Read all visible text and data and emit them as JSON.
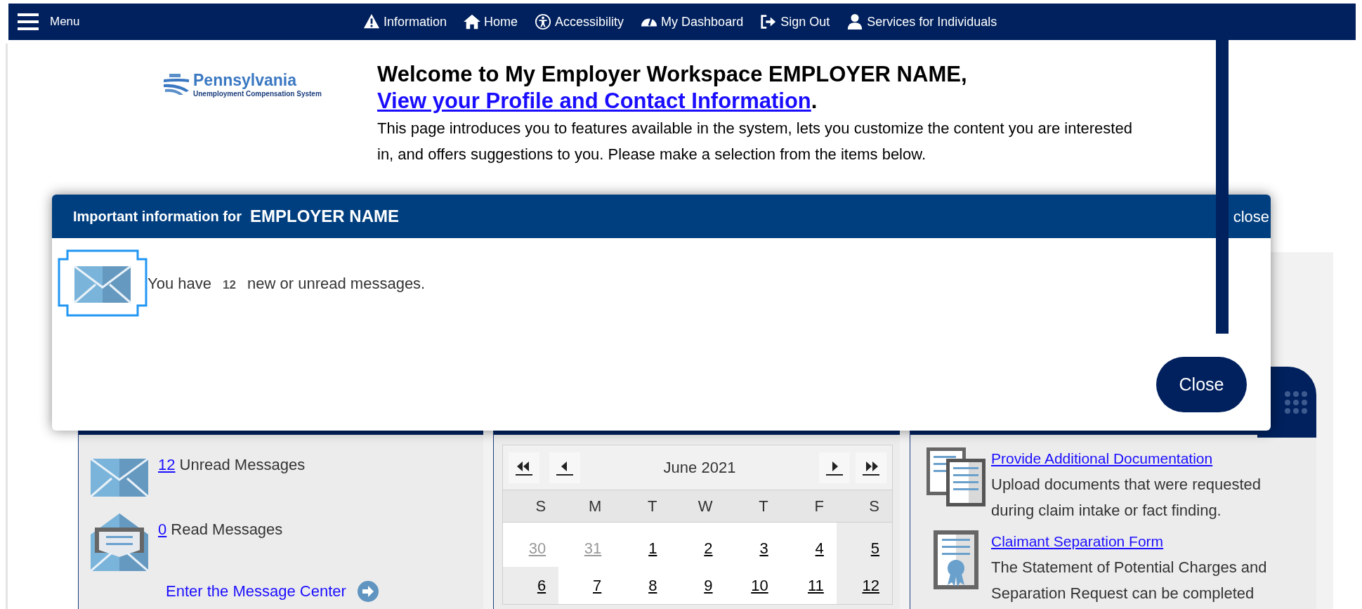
{
  "top_nav": {
    "menu_label": "Menu",
    "items": [
      {
        "label": "Information"
      },
      {
        "label": "Home"
      },
      {
        "label": "Accessibility"
      },
      {
        "label": "My Dashboard"
      },
      {
        "label": "Sign Out"
      },
      {
        "label": "Services for Individuals"
      }
    ]
  },
  "header": {
    "logo": {
      "title": "Pennsylvania",
      "subtitle": "Unemployment Compensation System"
    },
    "welcome": "Welcome to My Employer Workspace",
    "employer_name": "EMPLOYER NAME,",
    "profile_link": "View your Profile and Contact Information",
    "link_end": ".",
    "intro": "This page introduces you to features available in the system, lets you customize the content you are interested in, and offers suggestions to you. Please make a selection from the items below."
  },
  "modal": {
    "title": "Important information for",
    "employer_name": "EMPLOYER NAME",
    "close_link": "close",
    "message_prefix": "You have",
    "message_count": "12",
    "message_suffix": "new or unread messages.",
    "button": "Close"
  },
  "messages_panel": {
    "unread_count": "12",
    "unread_label": "Unread Messages",
    "read_count": "0",
    "read_label": "Read Messages",
    "link": "Enter the Message Center"
  },
  "calendar": {
    "month": "June 2021",
    "weekdays": [
      "S",
      "M",
      "T",
      "W",
      "T",
      "F",
      "S"
    ],
    "weeks": [
      [
        {
          "day": "30",
          "other_month": true
        },
        {
          "day": "31",
          "other_month": true
        },
        {
          "day": "1",
          "other_month": false
        },
        {
          "day": "2",
          "other_month": false
        },
        {
          "day": "3",
          "other_month": false
        },
        {
          "day": "4",
          "other_month": false
        },
        {
          "day": "5",
          "other_month": false
        }
      ],
      [
        {
          "day": "6",
          "other_month": false
        },
        {
          "day": "7",
          "other_month": false
        },
        {
          "day": "8",
          "other_month": false
        },
        {
          "day": "9",
          "other_month": false
        },
        {
          "day": "10",
          "other_month": false
        },
        {
          "day": "11",
          "other_month": false
        },
        {
          "day": "12",
          "other_month": false
        }
      ]
    ]
  },
  "resources_panel": {
    "items": [
      {
        "kind": "documents",
        "title": "Provide Additional Documentation",
        "description": "Upload documents that were requested during claim intake or fact finding."
      },
      {
        "kind": "certificate",
        "title": "Claimant Separation Form",
        "description": "The Statement of Potential Charges and Separation Request can be completed"
      }
    ]
  }
}
